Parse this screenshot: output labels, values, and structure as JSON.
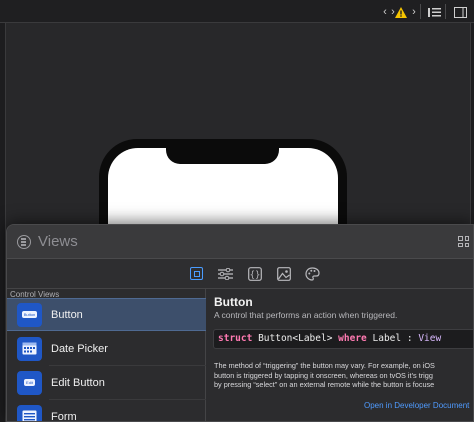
{
  "toolbar": {
    "icons": [
      "chevron-left-icon",
      "chevron-right-icon",
      "warning-icon",
      "list-icon",
      "inspector-icon"
    ]
  },
  "library": {
    "search_placeholder": "Views",
    "tabs": [
      "views",
      "modifiers",
      "snippets",
      "media",
      "colors"
    ],
    "active_tab": "views",
    "section_title": "Control Views",
    "items": [
      {
        "label": "Button",
        "icon_text": "Button",
        "selected": true
      },
      {
        "label": "Date Picker",
        "icon_text": "",
        "selected": false
      },
      {
        "label": "Edit Button",
        "icon_text": "Edit",
        "selected": false
      },
      {
        "label": "Form",
        "icon_text": "",
        "selected": false
      }
    ],
    "detail": {
      "title": "Button",
      "subtitle": "A control that performs an action when triggered.",
      "code": {
        "kw1": "struct",
        "name": "Button<Label>",
        "kw2": "where",
        "label": "Label",
        "colon": ":",
        "type": "View"
      },
      "body_lines": [
        "The method of “triggering” the button may vary. For example, on iOS",
        "button is triggered by tapping it onscreen, whereas on tvOS it’s trigg",
        "by pressing “select” on an external remote while the button is focuse"
      ],
      "link": "Open in Developer Document"
    }
  },
  "colors": {
    "accent": "#4a9cff",
    "warning": "#f5c400",
    "icon_blue": "#1f57c6"
  }
}
